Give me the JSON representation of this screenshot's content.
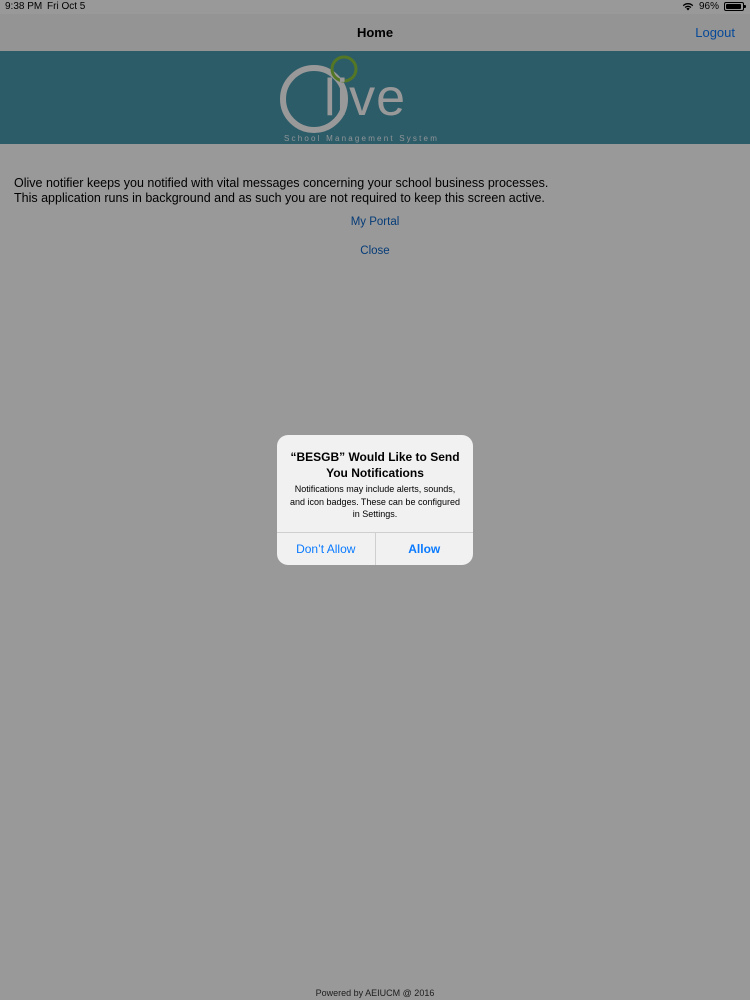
{
  "status_bar": {
    "time": "9:38 PM",
    "date": "Fri Oct 5",
    "battery": "96%",
    "battery_level": 0.96
  },
  "nav": {
    "title": "Home",
    "logout_label": "Logout"
  },
  "banner": {
    "logo_text": "live",
    "logo_subtitle": "School Management System",
    "background_color": "#4c99af",
    "accent_color": "#8dc63f"
  },
  "main": {
    "message_line1": "Olive notifier keeps you notified with vital messages concerning your school business processes.",
    "message_line2": "This application runs in background and as such you are not required to keep this screen active.",
    "my_portal_label": "My Portal",
    "close_label": "Close"
  },
  "footer": {
    "text": "Powered by AEIUCM @ 2016"
  },
  "alert": {
    "title": "“BESGB” Would Like to Send You Notifications",
    "message": "Notifications may include alerts, sounds, and icon badges. These can be configured in Settings.",
    "dont_allow_label": "Don’t Allow",
    "allow_label": "Allow"
  },
  "icons": {
    "wifi": "wifi-icon",
    "battery": "battery-icon"
  }
}
